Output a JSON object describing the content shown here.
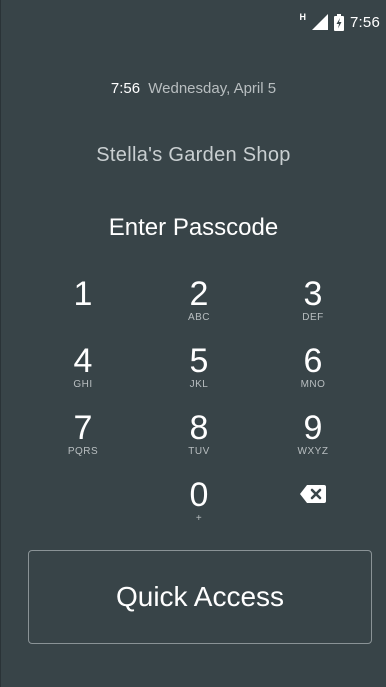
{
  "status_bar": {
    "network_label": "H",
    "time": "7:56",
    "signal_icon": "signal-icon",
    "battery_icon": "battery-charging-icon"
  },
  "lock": {
    "time": "7:56",
    "date": "Wednesday, April 5",
    "shop_name": "Stella's Garden Shop",
    "title": "Enter Passcode"
  },
  "keypad": {
    "keys": [
      {
        "digit": "1",
        "letters": ""
      },
      {
        "digit": "2",
        "letters": "ABC"
      },
      {
        "digit": "3",
        "letters": "DEF"
      },
      {
        "digit": "4",
        "letters": "GHI"
      },
      {
        "digit": "5",
        "letters": "JKL"
      },
      {
        "digit": "6",
        "letters": "MNO"
      },
      {
        "digit": "7",
        "letters": "PQRS"
      },
      {
        "digit": "8",
        "letters": "TUV"
      },
      {
        "digit": "9",
        "letters": "WXYZ"
      },
      {
        "digit": "0",
        "letters": "+"
      }
    ],
    "backspace_icon": "backspace-icon"
  },
  "quick_access": {
    "label": "Quick Access"
  },
  "colors": {
    "background": "#384448",
    "text": "#ffffff",
    "muted": "#b8bec0",
    "border": "#8a9396"
  }
}
